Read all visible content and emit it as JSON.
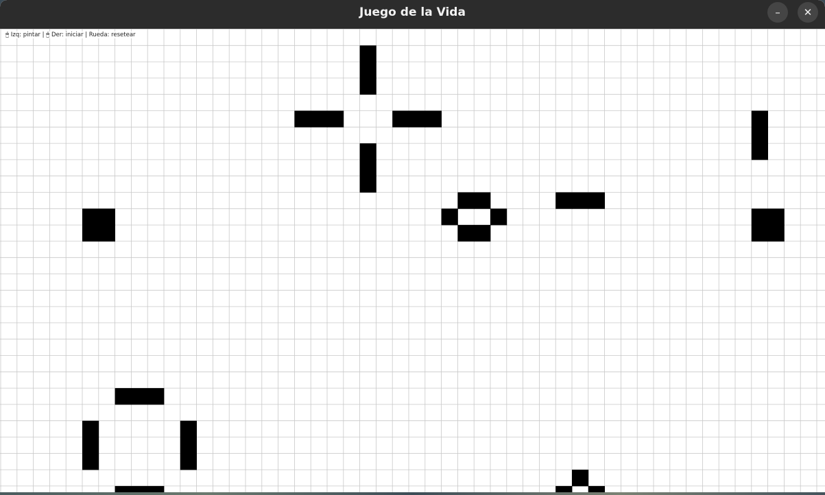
{
  "window": {
    "title": "Juego de la Vida",
    "minimize_symbol": "–",
    "close_symbol": "✕"
  },
  "hint": {
    "text": "🖱 Izq: pintar | 🖱 Der: iniciar | Rueda: resetear"
  },
  "colors": {
    "titlebar": "#2c2c2c",
    "grid_line": "#c8c8c8",
    "alive_cell": "#000000",
    "dead_cell": "#ffffff"
  },
  "board": {
    "columns": 50,
    "visible_rows": 29,
    "alive_cells": [
      [
        22,
        1
      ],
      [
        22,
        2
      ],
      [
        22,
        3
      ],
      [
        18,
        5
      ],
      [
        19,
        5
      ],
      [
        20,
        5
      ],
      [
        24,
        5
      ],
      [
        25,
        5
      ],
      [
        26,
        5
      ],
      [
        22,
        7
      ],
      [
        22,
        8
      ],
      [
        22,
        9
      ],
      [
        46,
        5
      ],
      [
        46,
        6
      ],
      [
        46,
        7
      ],
      [
        5,
        11
      ],
      [
        6,
        11
      ],
      [
        5,
        12
      ],
      [
        6,
        12
      ],
      [
        28,
        10
      ],
      [
        29,
        10
      ],
      [
        27,
        11
      ],
      [
        30,
        11
      ],
      [
        28,
        12
      ],
      [
        29,
        12
      ],
      [
        34,
        10
      ],
      [
        35,
        10
      ],
      [
        36,
        10
      ],
      [
        46,
        11
      ],
      [
        47,
        11
      ],
      [
        46,
        12
      ],
      [
        47,
        12
      ],
      [
        7,
        22
      ],
      [
        8,
        22
      ],
      [
        9,
        22
      ],
      [
        5,
        24
      ],
      [
        5,
        25
      ],
      [
        5,
        26
      ],
      [
        11,
        24
      ],
      [
        11,
        25
      ],
      [
        11,
        26
      ],
      [
        7,
        28
      ],
      [
        8,
        28
      ],
      [
        9,
        28
      ],
      [
        35,
        27
      ],
      [
        34,
        28
      ],
      [
        36,
        28
      ]
    ]
  }
}
